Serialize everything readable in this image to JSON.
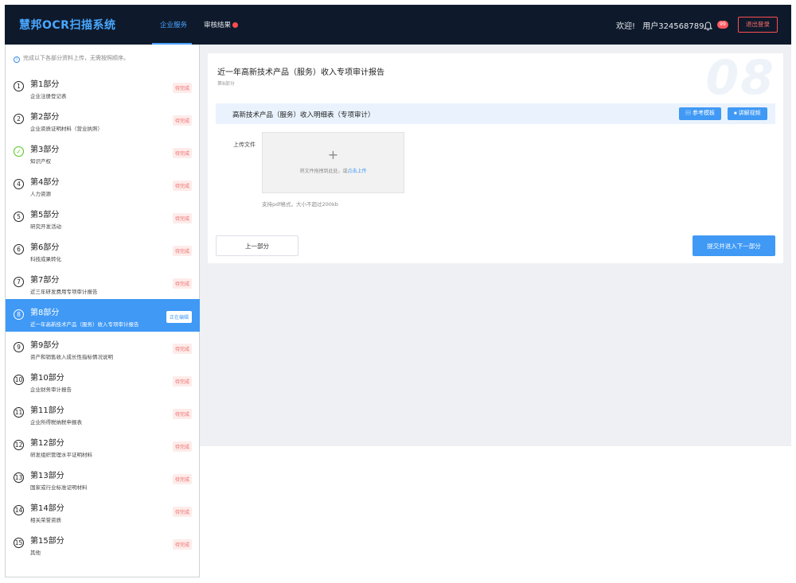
{
  "app": {
    "title": "慧邦OCR扫描系统"
  },
  "nav": {
    "tabs": [
      {
        "label": "企业服务",
        "active": true
      },
      {
        "label": "审核结果",
        "active": false,
        "has_dot": true
      }
    ]
  },
  "header": {
    "welcome": "欢迎!",
    "user": "用户324568789",
    "notifications_count": "99",
    "logout_label": "退出登录"
  },
  "sidebar": {
    "tip": "完成以下各部分资料上传，无需按照顺序。",
    "steps": [
      {
        "num": "1",
        "title": "第1部分",
        "sub": "企业注册登记表",
        "status": "待完成"
      },
      {
        "num": "2",
        "title": "第2部分",
        "sub": "企业资质证明材料（营业执照）",
        "status": "待完成"
      },
      {
        "num": "✓",
        "title": "第3部分",
        "sub": "知识产权",
        "status": "待完成",
        "done": true
      },
      {
        "num": "4",
        "title": "第4部分",
        "sub": "人力资源",
        "status": "待完成"
      },
      {
        "num": "5",
        "title": "第5部分",
        "sub": "研究开发活动",
        "status": "待完成"
      },
      {
        "num": "6",
        "title": "第6部分",
        "sub": "科技成果转化",
        "status": "待完成"
      },
      {
        "num": "7",
        "title": "第7部分",
        "sub": "近三年研发费用专项审计报告",
        "status": "待完成"
      },
      {
        "num": "8",
        "title": "第8部分",
        "sub": "近一年高新技术产品（服务）收入专项审计报告",
        "status": "正在编辑",
        "active": true
      },
      {
        "num": "9",
        "title": "第9部分",
        "sub": "资产和销售收入成长性指标情况说明",
        "status": "待完成"
      },
      {
        "num": "10",
        "title": "第10部分",
        "sub": "企业财务审计报告",
        "status": "待完成"
      },
      {
        "num": "11",
        "title": "第11部分",
        "sub": "企业所得税纳税申报表",
        "status": "待完成"
      },
      {
        "num": "12",
        "title": "第12部分",
        "sub": "研发组织管理水平证明材料",
        "status": "待完成"
      },
      {
        "num": "13",
        "title": "第13部分",
        "sub": "国家或行业标准证明材料",
        "status": "待完成"
      },
      {
        "num": "14",
        "title": "第14部分",
        "sub": "相关荣誉资质",
        "status": "待完成"
      },
      {
        "num": "15",
        "title": "第15部分",
        "sub": "其他",
        "status": "待完成"
      }
    ]
  },
  "main": {
    "title": "近一年高新技术产品（服务）收入专项审计报告",
    "subtitle": "第8部分",
    "watermark": "08",
    "section": {
      "title": "高新技术产品（服务）收入明细表（专项审计）",
      "template_button": "参考模板",
      "video_button": "讲解视频"
    },
    "upload": {
      "label": "上传文件",
      "hint_prefix": "将文件拖拽到此处，或",
      "hint_link": "点击上传",
      "support": "支持pdf格式，大小不超过200kb"
    },
    "prev_button": "上一部分",
    "next_button": "提交并进入下一部分"
  },
  "colors": {
    "topbar": "#0e1a2c",
    "accent": "#3f99f5",
    "pending_badge": "#ee6a6a",
    "done": "#52c41a"
  },
  "icons": {
    "info": "info-icon",
    "bell": "bell-icon",
    "check": "check-icon",
    "document": "document-icon",
    "video": "video-icon",
    "plus": "plus-icon"
  }
}
